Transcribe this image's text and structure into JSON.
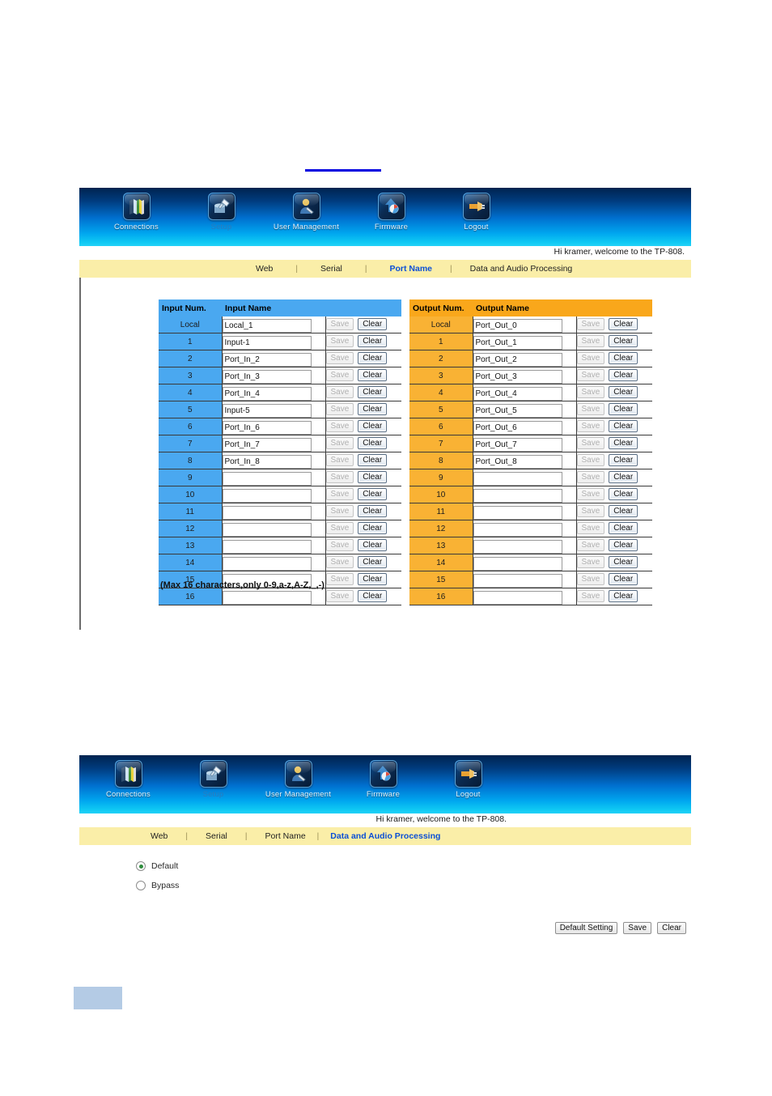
{
  "nav": {
    "items": [
      {
        "label": "Connections",
        "icon": "books-icon",
        "dim": false
      },
      {
        "label": "Setup",
        "icon": "setup-wrench-icon",
        "dim": true
      },
      {
        "label": "User Management",
        "icon": "user-management-icon",
        "dim": false
      },
      {
        "label": "Firmware",
        "icon": "firmware-upload-icon",
        "dim": false
      },
      {
        "label": "Logout",
        "icon": "logout-plug-icon",
        "dim": false
      }
    ]
  },
  "welcome": "Hi kramer, welcome to the TP-808.",
  "tabs_port_name": [
    {
      "label": "Web",
      "active": false
    },
    {
      "label": "Serial",
      "active": false
    },
    {
      "label": "Port Name",
      "active": true
    },
    {
      "label": "Data and Audio Processing",
      "active": false
    }
  ],
  "tabs_data_audio": [
    {
      "label": "Web",
      "active": false
    },
    {
      "label": "Serial",
      "active": false
    },
    {
      "label": "Port Name",
      "active": false
    },
    {
      "label": "Data and Audio Processing",
      "active": true
    }
  ],
  "input_table": {
    "header_num": "Input Num.",
    "header_name": "Input Name",
    "rows": [
      {
        "num": "Local",
        "name": "Local_1"
      },
      {
        "num": "1",
        "name": "Input-1"
      },
      {
        "num": "2",
        "name": "Port_In_2"
      },
      {
        "num": "3",
        "name": "Port_In_3"
      },
      {
        "num": "4",
        "name": "Port_In_4"
      },
      {
        "num": "5",
        "name": "Input-5"
      },
      {
        "num": "6",
        "name": "Port_In_6"
      },
      {
        "num": "7",
        "name": "Port_In_7"
      },
      {
        "num": "8",
        "name": "Port_In_8"
      },
      {
        "num": "9",
        "name": ""
      },
      {
        "num": "10",
        "name": ""
      },
      {
        "num": "11",
        "name": ""
      },
      {
        "num": "12",
        "name": ""
      },
      {
        "num": "13",
        "name": ""
      },
      {
        "num": "14",
        "name": ""
      },
      {
        "num": "15",
        "name": ""
      },
      {
        "num": "16",
        "name": ""
      }
    ]
  },
  "output_table": {
    "header_num": "Output Num.",
    "header_name": "Output Name",
    "rows": [
      {
        "num": "Local",
        "name": "Port_Out_0"
      },
      {
        "num": "1",
        "name": "Port_Out_1"
      },
      {
        "num": "2",
        "name": "Port_Out_2"
      },
      {
        "num": "3",
        "name": "Port_Out_3"
      },
      {
        "num": "4",
        "name": "Port_Out_4"
      },
      {
        "num": "5",
        "name": "Port_Out_5"
      },
      {
        "num": "6",
        "name": "Port_Out_6"
      },
      {
        "num": "7",
        "name": "Port_Out_7"
      },
      {
        "num": "8",
        "name": "Port_Out_8"
      },
      {
        "num": "9",
        "name": ""
      },
      {
        "num": "10",
        "name": ""
      },
      {
        "num": "11",
        "name": ""
      },
      {
        "num": "12",
        "name": ""
      },
      {
        "num": "13",
        "name": ""
      },
      {
        "num": "14",
        "name": ""
      },
      {
        "num": "15",
        "name": ""
      },
      {
        "num": "16",
        "name": ""
      }
    ]
  },
  "row_buttons": {
    "save_label": "Save",
    "clear_label": "Clear"
  },
  "note": "(Max 16 characters,only 0-9,a-z,A-Z,_,-)",
  "data_audio": {
    "options": [
      {
        "label": "Default",
        "selected": true
      },
      {
        "label": "Bypass",
        "selected": false
      }
    ],
    "buttons": [
      {
        "label": "Default Setting"
      },
      {
        "label": "Save"
      },
      {
        "label": "Clear"
      }
    ]
  },
  "colors": {
    "input_header": "#4aa8f0",
    "output_header": "#f9a71b",
    "output_cell": "#f9b234",
    "tab_bar": "#faeea8",
    "active_tab": "#0b4fd6",
    "rule": "#0000e0",
    "block": "#b4cbe5"
  }
}
